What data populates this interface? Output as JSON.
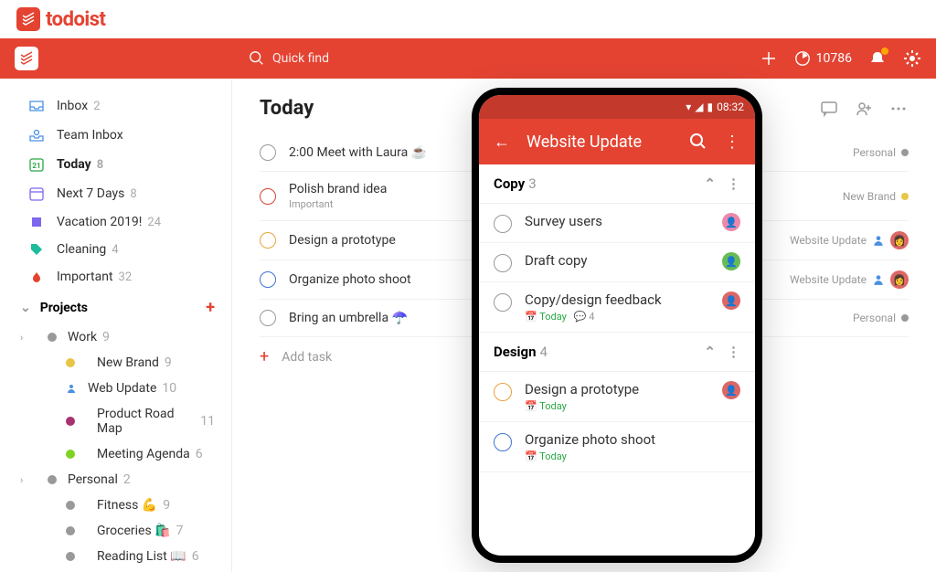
{
  "brand": "todoist",
  "topbar": {
    "search_placeholder": "Quick find",
    "karma": "10786"
  },
  "sidebar": {
    "filters": [
      {
        "icon": "inbox",
        "label": "Inbox",
        "count": "2",
        "color": "#4a90e2"
      },
      {
        "icon": "team-inbox",
        "label": "Team Inbox",
        "count": "",
        "color": "#4a90e2"
      },
      {
        "icon": "today",
        "label": "Today",
        "count": "8",
        "color": "#28a745",
        "bold": true
      },
      {
        "icon": "week",
        "label": "Next 7 Days",
        "count": "8",
        "color": "#7b68ee"
      },
      {
        "icon": "filter",
        "label": "Vacation 2019!",
        "count": "24",
        "color": "#7b68ee"
      },
      {
        "icon": "tag",
        "label": "Cleaning",
        "count": "4",
        "color": "#1abc9c"
      },
      {
        "icon": "flame",
        "label": "Important",
        "count": "32",
        "color": "#e44332"
      }
    ],
    "projects_label": "Projects",
    "projects": [
      {
        "label": "Work",
        "count": "9",
        "color": "#999",
        "expand": true,
        "subs": [
          {
            "label": "New Brand",
            "count": "9",
            "color": "#e8c547"
          },
          {
            "label": "Web Update",
            "count": "10",
            "color": "#4a90e2",
            "icon": "person"
          },
          {
            "label": "Product Road Map",
            "count": "11",
            "color": "#a8326f"
          },
          {
            "label": "Meeting Agenda",
            "count": "6",
            "color": "#7ed321"
          }
        ]
      },
      {
        "label": "Personal",
        "count": "2",
        "color": "#999",
        "expand": true,
        "subs": [
          {
            "label": "Fitness 💪",
            "count": "9",
            "color": "#999"
          },
          {
            "label": "Groceries 🛍️",
            "count": "7",
            "color": "#999"
          },
          {
            "label": "Reading List 📖",
            "count": "6",
            "color": "#999"
          }
        ]
      }
    ]
  },
  "page": {
    "title": "Today",
    "tasks": [
      {
        "priority": "",
        "text": "2:00 Meet with Laura ☕",
        "sub": "",
        "project": "Personal",
        "pcolor": "#999"
      },
      {
        "priority": "p1",
        "text": "Polish brand idea",
        "sub": "Important",
        "project": "New Brand",
        "pcolor": "#e8c547"
      },
      {
        "priority": "p2",
        "text": "Design a prototype",
        "sub": "",
        "project": "Website Update",
        "pcolor": "",
        "assigned": true,
        "avatar": true
      },
      {
        "priority": "p3",
        "text": "Organize photo shoot",
        "sub": "",
        "project": "Website Update",
        "pcolor": "",
        "assigned": true,
        "avatar": true
      },
      {
        "priority": "",
        "text": "Bring an umbrella ☂️",
        "sub": "",
        "project": "Personal",
        "pcolor": "#999"
      }
    ],
    "add_task": "Add task"
  },
  "phone": {
    "time": "08:32",
    "title": "Website Update",
    "sections": [
      {
        "name": "Copy",
        "count": "3",
        "tasks": [
          {
            "text": "Survey users",
            "priority": "",
            "today": "",
            "avatar": "#e8a"
          },
          {
            "text": "Draft copy",
            "priority": "",
            "today": "",
            "avatar": "#6b5"
          },
          {
            "text": "Copy/design feedback",
            "priority": "",
            "today": "Today",
            "comments": "4",
            "avatar": "#d66"
          }
        ]
      },
      {
        "name": "Design",
        "count": "4",
        "tasks": [
          {
            "text": "Design a prototype",
            "priority": "p2",
            "today": "Today",
            "avatar": "#d66"
          },
          {
            "text": "Organize photo shoot",
            "priority": "p3",
            "today": "Today",
            "avatar": ""
          }
        ]
      }
    ]
  }
}
